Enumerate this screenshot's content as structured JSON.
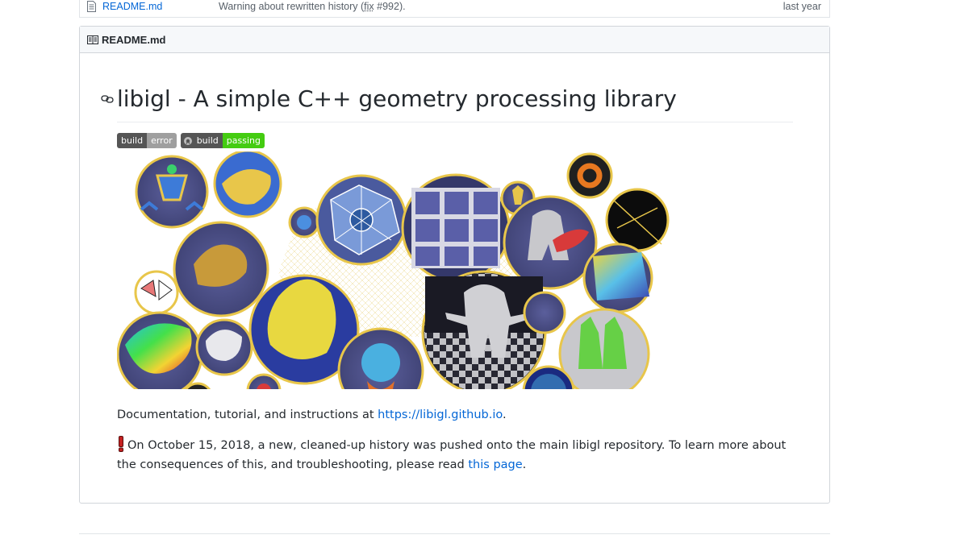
{
  "file_row": {
    "name": "README.md",
    "message_before": "Warning about rewritten history (",
    "message_fix": "fix",
    "message_after": " #992).",
    "age": "last year",
    "icon": "file-text-icon"
  },
  "readme": {
    "header_label": "README.md",
    "header_icon": "book-icon",
    "title": "libigl - A simple C++ geometry processing library",
    "badges": [
      {
        "left": "build",
        "right": "error",
        "right_color": "#9f9f9f"
      },
      {
        "left": "build",
        "right": "passing",
        "right_color": "#44cc11",
        "logo": "appveyor-icon"
      }
    ],
    "doc_prefix": "Documentation, tutorial, and instructions at ",
    "doc_link": "https://libigl.github.io",
    "doc_suffix": ".",
    "note_icon": "exclamation-icon",
    "note_text": "On October 15, 2018, a new, cleaned-up history was pushed onto the main libigl repository. To learn more about the consequences of this, and troubleshooting, please read ",
    "note_link": "this page",
    "note_suffix": "."
  },
  "colors": {
    "link": "#0366d6",
    "circle_border": "#e8c64a",
    "circle_fill": "#4a4f84"
  }
}
